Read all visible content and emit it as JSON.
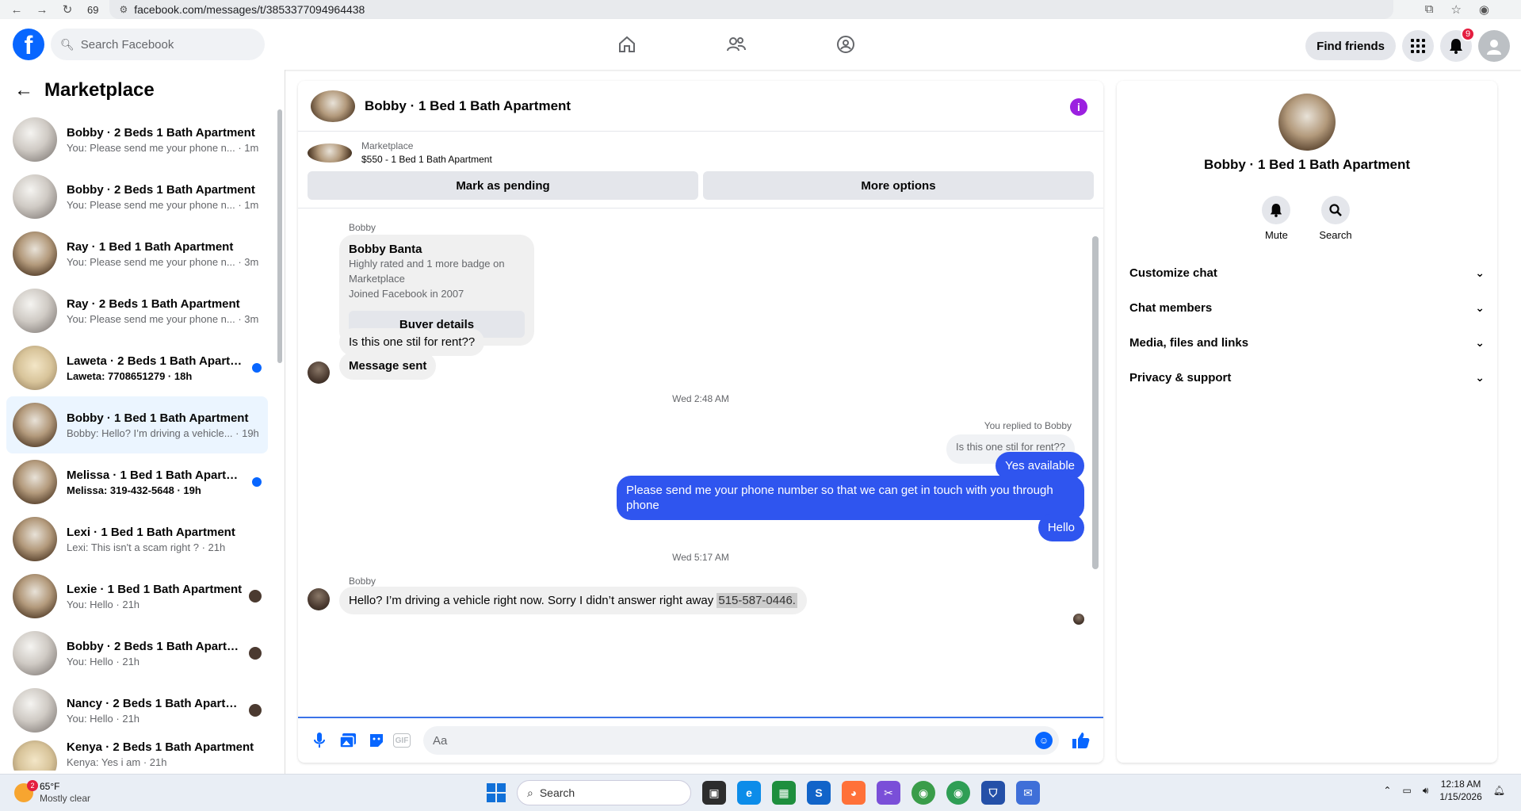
{
  "browser": {
    "tab_count": "69",
    "url": "facebook.com/messages/t/3853377094964438"
  },
  "header": {
    "search_placeholder": "Search Facebook",
    "find_friends": "Find friends",
    "notification_count": "9"
  },
  "sidebar": {
    "title": "Marketplace",
    "conversations": [
      {
        "name": "Bobby · 2 Beds 1 Bath Apartment",
        "preview": "You: Please send me your phone n... · 1m",
        "unread": false
      },
      {
        "name": "Bobby · 2 Beds 1 Bath Apartment",
        "preview": "You: Please send me your phone n... · 1m",
        "unread": false
      },
      {
        "name": "Ray · 1 Bed 1 Bath Apartment",
        "preview": "You: Please send me your phone n... · 3m",
        "unread": false
      },
      {
        "name": "Ray · 2 Beds 1 Bath Apartment",
        "preview": "You: Please send me your phone n... · 3m",
        "unread": false
      },
      {
        "name": "Laweta · 2 Beds 1 Bath Apartm...",
        "preview": "Laweta: 7708651279 · 18h",
        "unread": true
      },
      {
        "name": "Bobby · 1 Bed 1 Bath Apartment",
        "preview": "Bobby: Hello? I’m driving a vehicle... · 19h",
        "unread": false
      },
      {
        "name": "Melissa · 1 Bed 1 Bath Apartme...",
        "preview": "Melissa: 319-432-5648 · 19h",
        "unread": true
      },
      {
        "name": "Lexi · 1 Bed 1 Bath Apartment",
        "preview": "Lexi: This isn't a scam right ? · 21h",
        "unread": false
      },
      {
        "name": "Lexie · 1 Bed 1 Bath Apartment",
        "preview": "You: Hello · 21h",
        "unread": false
      },
      {
        "name": "Bobby · 2 Beds 1 Bath Apartm...",
        "preview": "You: Hello · 21h",
        "unread": false
      },
      {
        "name": "Nancy · 2 Beds 1 Bath Apartm...",
        "preview": "You: Hello · 21h",
        "unread": false
      },
      {
        "name": "Kenya · 2 Beds 1 Bath Apartment",
        "preview": "Kenya: Yes i am · 21h",
        "unread": false
      }
    ]
  },
  "chat": {
    "title": "Bobby · 1 Bed 1 Bath Apartment",
    "marketplace_label": "Marketplace",
    "listing": "$550 - 1 Bed 1 Bath Apartment",
    "mark_pending": "Mark as pending",
    "more_options": "More options",
    "sender_name": "Bobby",
    "card": {
      "name": "Bobby Banta",
      "line1": "Highly rated and 1 more badge on",
      "line2": "Marketplace",
      "line3": "Joined Facebook in 2007",
      "button": "Buyer details"
    },
    "msg1": "Is this one stil for rent??",
    "msg2": "Message sent",
    "time1": "Wed 2:48 AM",
    "replied_to": "You replied to Bobby",
    "quoted": "Is this one stil for rent??",
    "me1": "Yes available",
    "me2": "Please send me your phone  number so that we can get in touch with you through phone",
    "me3": "Hello",
    "time2": "Wed 5:17 AM",
    "sender_name2": "Bobby",
    "last_msg": "Hello? I’m driving a vehicle right now. Sorry I didn’t answer right away ",
    "last_phone": "515-587-0446.",
    "composer_placeholder": "Aa"
  },
  "right_panel": {
    "name": "Bobby · 1 Bed 1 Bath Apartment",
    "mute": "Mute",
    "search": "Search",
    "sections": [
      "Customize chat",
      "Chat members",
      "Media, files and links",
      "Privacy & support"
    ]
  },
  "taskbar": {
    "temp": "65°F",
    "weather": "Mostly clear",
    "weather_badge": "2",
    "search": "Search",
    "time": "12:18 AM",
    "date": "1/15/2026"
  }
}
